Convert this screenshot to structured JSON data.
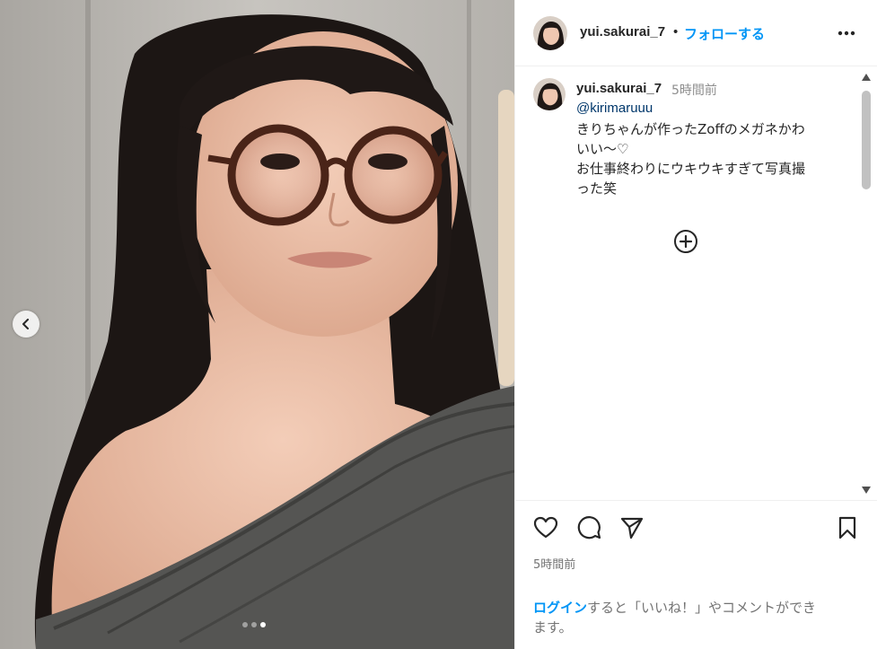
{
  "post": {
    "username": "yui.sakurai_7",
    "separator": "•",
    "follow_label": "フォローする",
    "more_icon": "more-horizontal-icon"
  },
  "caption": {
    "username": "yui.sakurai_7",
    "time": "5時間前",
    "mention": "@kirimaruuu",
    "lines": [
      "きりちゃんが作ったZoffのメガネかわ",
      "いい〜♡",
      "お仕事終わりにウキウキすぎて写真撮",
      "った笑"
    ]
  },
  "media": {
    "carousel_total": 3,
    "carousel_active": 3,
    "prev_icon": "chevron-left-icon"
  },
  "actions": {
    "like_icon": "heart-icon",
    "comment_icon": "comment-icon",
    "share_icon": "paper-plane-icon",
    "save_icon": "bookmark-icon",
    "time": "5時間前"
  },
  "login_prompt": {
    "link": "ログイン",
    "rest_line1": "すると「いいね！」やコメントができ",
    "line2": "ます。"
  },
  "colors": {
    "accent": "#0095f6",
    "mention": "#00376b",
    "muted": "#8e8e8e"
  }
}
